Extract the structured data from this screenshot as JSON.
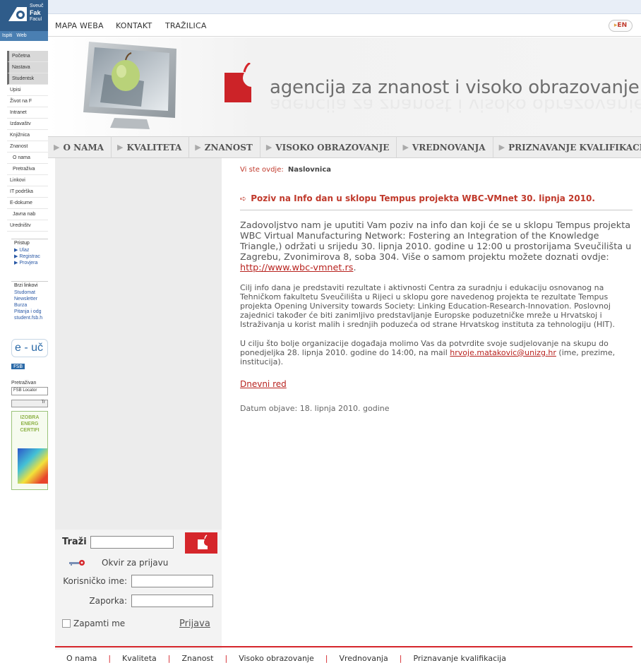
{
  "fsb_window": {
    "logo_lines": [
      "Sveuč",
      "Fak",
      "Facul"
    ],
    "tabs": [
      "Ispiti",
      "Web"
    ],
    "menu": [
      {
        "label": "Početna",
        "style": "dark"
      },
      {
        "label": "Nastava",
        "style": "dark"
      },
      {
        "label": "Studentsk",
        "style": "dark"
      },
      {
        "label": "Upisi",
        "style": "plain"
      },
      {
        "label": "Život na F",
        "style": "plain"
      },
      {
        "label": "Intranet",
        "style": "plain"
      },
      {
        "label": "Izdavaštv",
        "style": "plain"
      },
      {
        "label": "Knjižnica",
        "style": "plain"
      },
      {
        "label": "Znanost",
        "style": "plain"
      },
      {
        "label": "O nama",
        "style": "sub"
      },
      {
        "label": "Pretraživa",
        "style": "sub"
      },
      {
        "label": "Linkovi",
        "style": "plain"
      },
      {
        "label": "IT podrška",
        "style": "plain"
      },
      {
        "label": "E-dokume",
        "style": "plain"
      },
      {
        "label": "Javna nab",
        "style": "sub"
      },
      {
        "label": "Uredništv",
        "style": "plain"
      }
    ],
    "pristup_title": "Pristup",
    "pristup_links": [
      "▶ Ulaz",
      "▶ Registrac",
      "▶ Provjera"
    ],
    "brzi_title": "Brzi linkovi",
    "brzi_links": [
      "Studomat",
      "Newsletter",
      "Burza",
      "Pitanja i odg",
      "student.fsb.h"
    ],
    "eucenje": "e - uč",
    "eucenje_sub": "FSB",
    "locator_label": "Pretraživan",
    "locator_value": "FSB Locator",
    "locator_btn": "Tr",
    "banner_lines": [
      "IZOBRA",
      "ENERG",
      "CERTIFI"
    ]
  },
  "topnav": {
    "links": [
      "MAPA WEBA",
      "KONTAKT",
      "TRAŽILICA"
    ],
    "lang": "EN"
  },
  "header": {
    "agency_name": "agencija za znanost i visoko obrazovanje"
  },
  "mainnav": {
    "items": [
      "O NAMA",
      "KVALITETA",
      "ZNANOST",
      "VISOKO OBRAZOVANJE",
      "VREDNOVANJA",
      "PRIZNAVANJE KVALIFIKACIJA"
    ]
  },
  "sidebar": {
    "search_label": "Traži",
    "search_value": "",
    "login_title": "Okvir za prijavu",
    "username_label": "Korisničko ime:",
    "password_label": "Zaporka:",
    "remember_label": "Zapamti me",
    "login_button": "Prijava"
  },
  "content": {
    "breadcrumb_prefix": "Vi ste ovdje:",
    "breadcrumb_current": "Naslovnica",
    "title": "Poziv na Info dan u sklopu Tempus projekta WBC-VMnet 30. lipnja 2010.",
    "p1_text": "Zadovoljstvo nam je uputiti Vam poziv na info dan koji će se u sklopu Tempus projekta WBC Virtual Manufacturing Network: Fostering an Integration of the Knowledge Triangle,) održati u srijedu 30. lipnja 2010. godine u 12:00 u prostorijama Sveučilišta u Zagrebu,  Zvonimirova 8, soba 304. Više o samom projektu možete doznati ovdje: ",
    "p1_link": "http://www.wbc-vmnet.rs",
    "p1_end": ".",
    "p2_text": "Cilj info dana je predstaviti rezultate i aktivnosti Centra za suradnju i edukaciju osnovanog  na Tehničkom fakultetu Sveučilišta u Rijeci u sklopu gore navedenog projekta te rezultate Tempus projekta Opening University towards Society: Linking Education-Research-Innovation. Poslovnoj zajednici također će biti zanimljivo predstavljanje Europske poduzetničke mreže u Hrvatskoj i Istraživanja u korist malih i srednjih poduzeća od strane Hrvatskog instituta za tehnologiju (HIT).",
    "p3_text": "U cilju što bolje organizacije događaja molimo Vas da potvrdite svoje sudjelovanje na skupu do ponedjeljka 28. lipnja 2010. godine do 14:00,  na mail ",
    "p3_link": "hrvoje.matakovic@unizg.hr",
    "p3_end": " (ime, prezime, institucija).",
    "agenda_link": "Dnevni red",
    "date": "Datum objave: 18. lipnja 2010. godine"
  },
  "footer": {
    "links": [
      "O nama",
      "Kvaliteta",
      "Znanost",
      "Visoko obrazovanje",
      "Vrednovanja",
      "Priznavanje kvalifikacija"
    ],
    "separator": "|"
  },
  "colors": {
    "accent_red": "#d5262b",
    "link_red": "#b8231f",
    "nav_gray": "#ededed"
  }
}
